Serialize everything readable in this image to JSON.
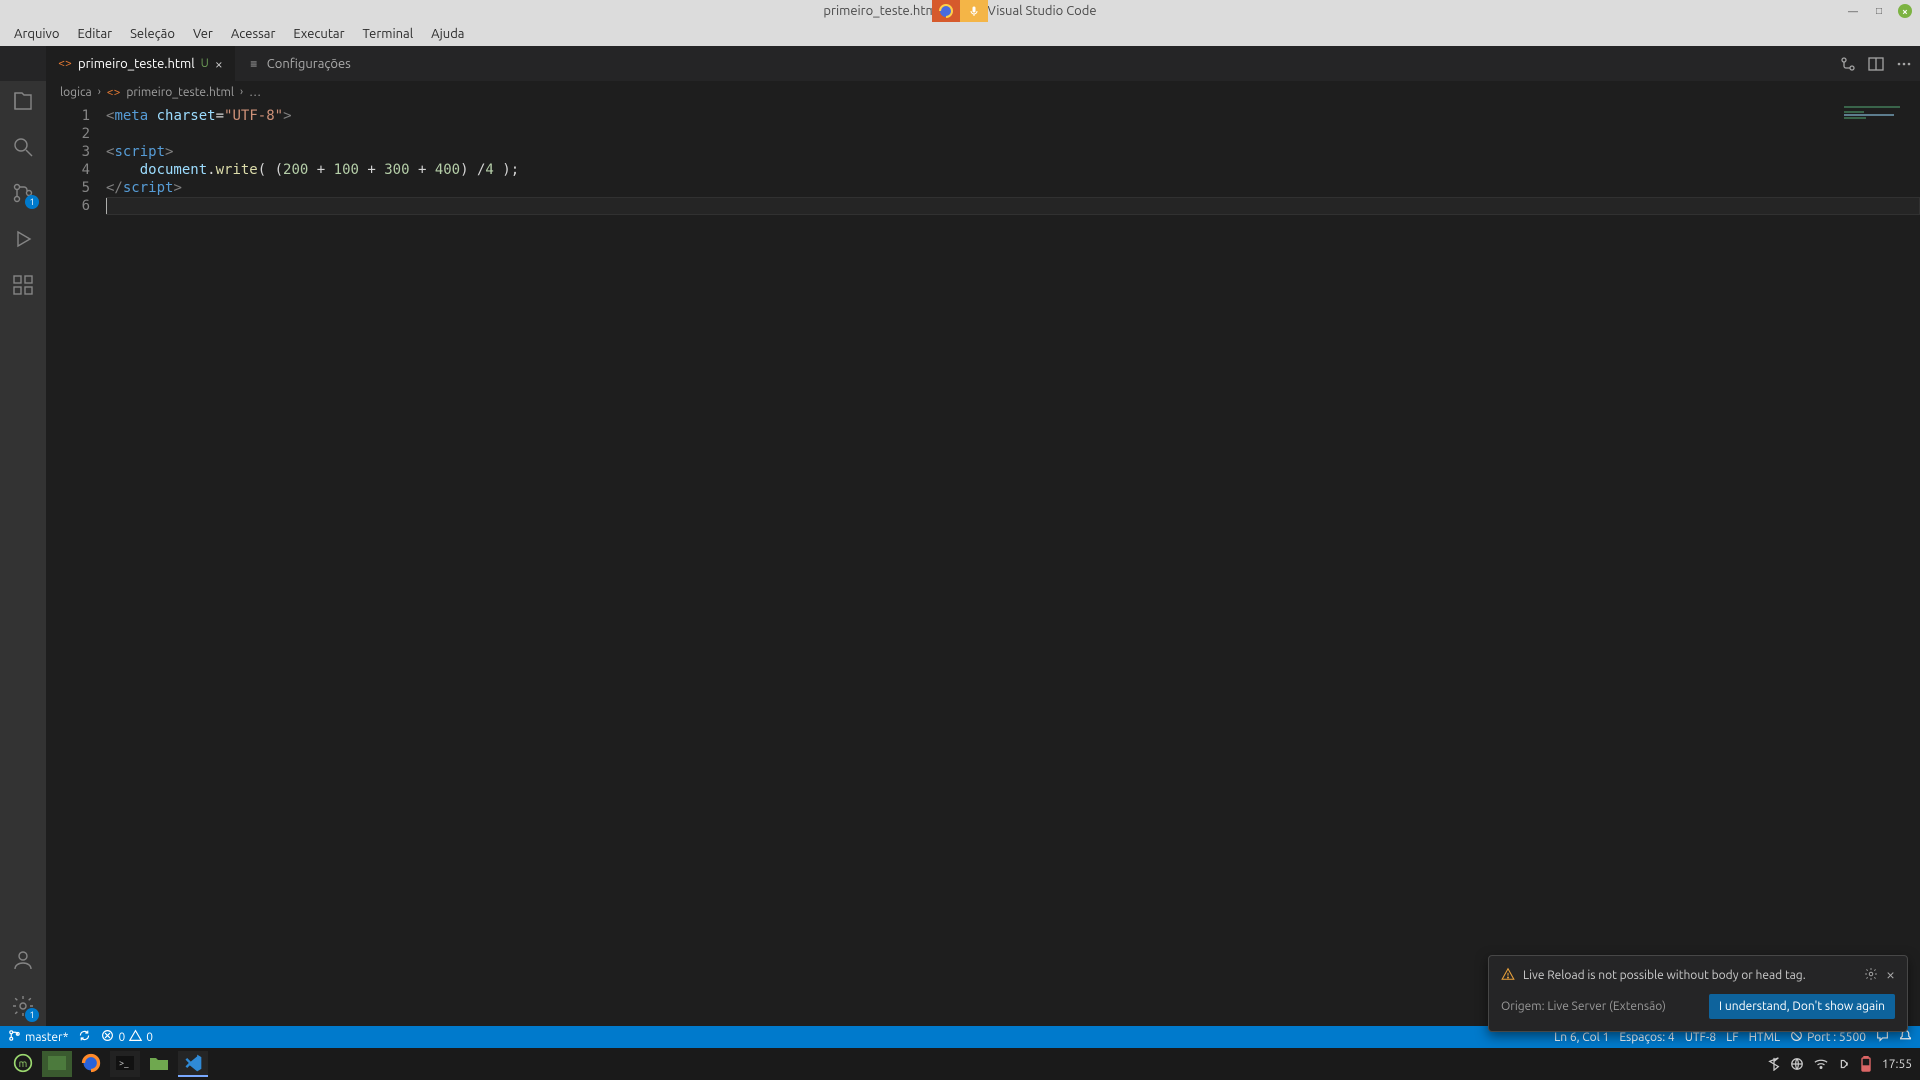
{
  "titlebar": {
    "title": "primeiro_teste.html - A           cle - Visual Studio Code",
    "min": "—",
    "max": "□",
    "close": "×"
  },
  "menus": [
    "Arquivo",
    "Editar",
    "Seleção",
    "Ver",
    "Acessar",
    "Executar",
    "Terminal",
    "Ajuda"
  ],
  "tabs": [
    {
      "label": "primeiro_teste.html",
      "icon": "<>",
      "status": "U",
      "active": true
    },
    {
      "label": "Configurações",
      "icon": "≡",
      "status": "",
      "active": false
    }
  ],
  "breadcrumb": {
    "folder": "logica",
    "file": "primeiro_teste.html",
    "tail": "…"
  },
  "activity": {
    "scm_badge": "1",
    "settings_badge": "1"
  },
  "code": {
    "lines": [
      {
        "n": "1",
        "seg": [
          [
            "tag-bracket",
            "<"
          ],
          [
            "keyword",
            "meta"
          ],
          [
            "punct",
            " "
          ],
          [
            "var",
            "charset"
          ],
          [
            "punct",
            "="
          ],
          [
            "string",
            "\"UTF-8\""
          ],
          [
            "tag-bracket",
            ">"
          ]
        ]
      },
      {
        "n": "2",
        "seg": []
      },
      {
        "n": "3",
        "seg": [
          [
            "tag-bracket",
            "<"
          ],
          [
            "keyword",
            "script"
          ],
          [
            "tag-bracket",
            ">"
          ]
        ]
      },
      {
        "n": "4",
        "seg": [
          [
            "punct",
            "    "
          ],
          [
            "var",
            "document"
          ],
          [
            "punct",
            "."
          ],
          [
            "func",
            "write"
          ],
          [
            "punct",
            "( ("
          ],
          [
            "number",
            "200"
          ],
          [
            "punct",
            " + "
          ],
          [
            "number",
            "100"
          ],
          [
            "punct",
            " + "
          ],
          [
            "number",
            "300"
          ],
          [
            "punct",
            " + "
          ],
          [
            "number",
            "400"
          ],
          [
            "punct",
            ") /"
          ],
          [
            "number",
            "4"
          ],
          [
            "punct",
            " );"
          ]
        ]
      },
      {
        "n": "5",
        "seg": [
          [
            "tag-bracket",
            "</"
          ],
          [
            "keyword",
            "script"
          ],
          [
            "tag-bracket",
            ">"
          ]
        ]
      },
      {
        "n": "6",
        "seg": [],
        "current": true
      }
    ]
  },
  "notification": {
    "title": "Live Reload is not possible without body or head tag.",
    "source": "Origem: Live Server (Extensão)",
    "button": "I understand, Don't show again"
  },
  "status": {
    "branch": "master*",
    "errors": "0",
    "warnings": "0",
    "cursor": "Ln 6, Col 1",
    "spaces": "Espaços: 4",
    "encoding": "UTF-8",
    "eol": "LF",
    "lang": "HTML",
    "port": "Port : 5500"
  },
  "taskbar": {
    "time": "17:55"
  }
}
